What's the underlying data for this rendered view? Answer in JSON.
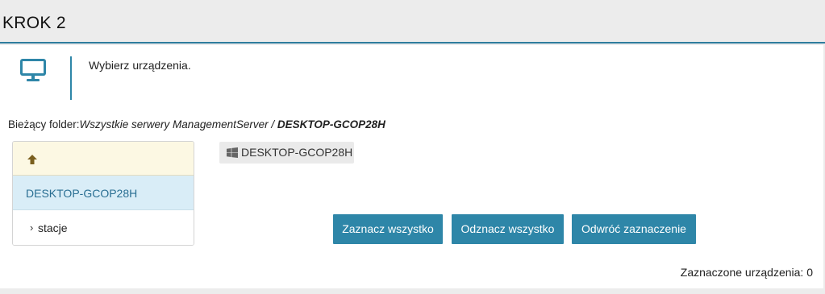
{
  "step": {
    "title": "KROK 2"
  },
  "instruction": {
    "text": "Wybierz urządzenia."
  },
  "icons": {
    "monitor": "monitor-icon",
    "up": "arrow-up-icon",
    "windows": "windows-icon",
    "chevron": "chevron-right-icon"
  },
  "colors": {
    "accent": "#2e86a8",
    "selected_row": "#d9edf7",
    "up_row": "#fcf8e3"
  },
  "breadcrumb": {
    "label": "Bieżący folder:",
    "path": "Wszystkie serwery ManagementServer / ",
    "current": "DESKTOP-GCOP28H"
  },
  "tree": {
    "selected": "DESKTOP-GCOP28H",
    "children": [
      {
        "chevron": "›",
        "label": "stacje"
      }
    ]
  },
  "devices": [
    {
      "name": "DESKTOP-GCOP28H"
    }
  ],
  "buttons": {
    "select_all": "Zaznacz wszystko",
    "deselect_all": "Odznacz wszystko",
    "invert": "Odwróć zaznaczenie"
  },
  "counter": {
    "label": "Zaznaczone urządzenia:",
    "value": "0"
  }
}
